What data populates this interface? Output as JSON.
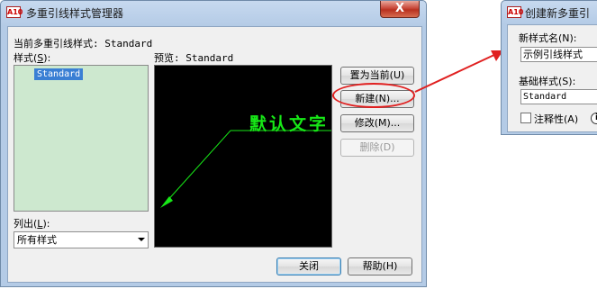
{
  "app_icon": {
    "text": "A10",
    "name": "autocad-icon"
  },
  "main_dialog": {
    "title": "多重引线样式管理器",
    "close_symbol": "X",
    "current_style_label": "当前多重引线样式: Standard",
    "styles_label": "样式(",
    "styles_hotkey": "S",
    "styles_label_end": "):",
    "styles": [
      "Standard"
    ],
    "preview_label": "预览: Standard",
    "preview_text": "默认文字",
    "list_label": "列出(",
    "list_hotkey": "L",
    "list_label_end": "):",
    "list_value": "所有样式",
    "buttons": {
      "set_current": "置为当前(U)",
      "new": "新建(N)...",
      "modify": "修改(M)...",
      "delete": "删除(D)",
      "close": "关闭",
      "help": "帮助(H)"
    }
  },
  "new_style_dialog": {
    "title": "创建新多重引",
    "new_name_label": "新样式名(N):",
    "new_name_value": "示例引线样式",
    "base_style_label": "基础样式(S):",
    "base_style_value": "Standard",
    "annotative_label": "注释性(A)",
    "info_icon": "i"
  },
  "colors": {
    "preview_bg": "#000000",
    "leader_green": "#17e817",
    "highlight_red": "#e02020",
    "list_bg": "#cde8cf",
    "selection": "#3a7fd4"
  }
}
